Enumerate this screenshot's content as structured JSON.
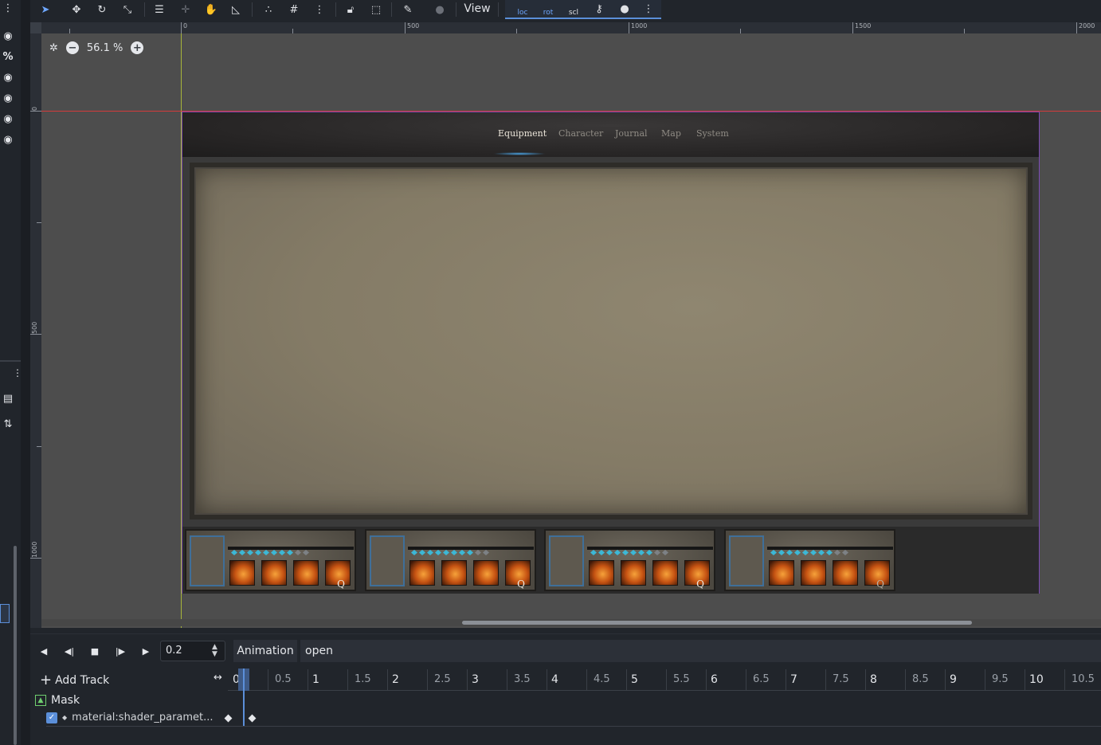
{
  "toolbar": {
    "view_label": "View",
    "icons": [
      "select-icon",
      "move-icon",
      "rotate-icon",
      "scale-icon",
      "list-select-icon",
      "pivot-icon",
      "pan-icon",
      "ruler-icon",
      "smart-snap-icon",
      "grid-snap-icon",
      "more-icon",
      "lock-icon",
      "group-icon",
      "bone-icon",
      "camera-icon"
    ],
    "keying": [
      "loc",
      "rot",
      "scl"
    ]
  },
  "viewport": {
    "zoom_label": "56.1 %",
    "ruler_h": [
      "0",
      "500",
      "1000",
      "1500",
      "2000"
    ],
    "ruler_v": [
      "0",
      "500",
      "1000"
    ]
  },
  "game_ui": {
    "tabs": [
      "Equipment",
      "Character",
      "Journal",
      "Map",
      "System"
    ],
    "active_tab": "Equipment",
    "slot_key": "Q"
  },
  "animation": {
    "time_value": "0.2",
    "animation_label": "Animation",
    "animation_name": "open",
    "add_track_label": "Add Track",
    "timeline_labels": [
      "0",
      "0.5",
      "1",
      "1.5",
      "2",
      "2.5",
      "3",
      "3.5",
      "4",
      "4.5",
      "5",
      "5.5",
      "6",
      "6.5",
      "7",
      "7.5",
      "8",
      "8.5",
      "9",
      "9.5",
      "10",
      "10.5"
    ],
    "track_group": "Mask",
    "track_name": "material:shader_paramet..."
  },
  "colors": {
    "accent": "#5b8fd9",
    "guide_vertical": "#a8b53a",
    "guide_horizontal": "#d43a3a",
    "scene_border": "#7c4bb5"
  }
}
